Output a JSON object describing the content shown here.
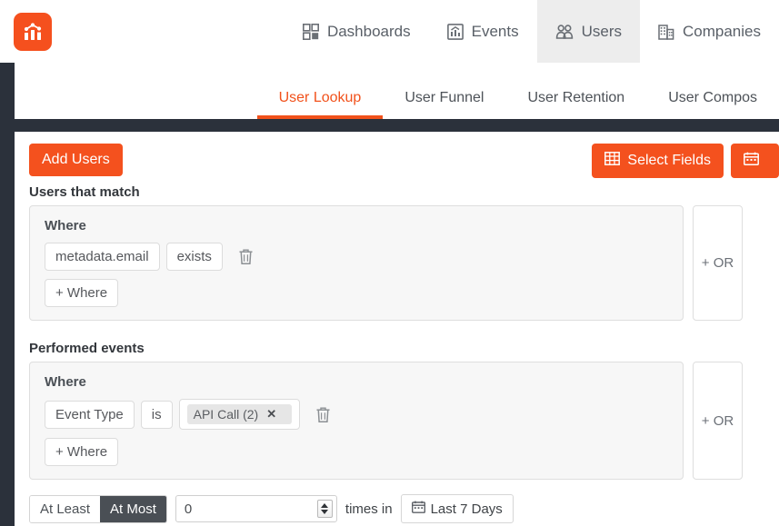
{
  "brand": {
    "logo_icon": "chart-m-logo-icon",
    "accent_color": "#f4511e",
    "dark_color": "#2b313b"
  },
  "topnav": {
    "items": [
      {
        "label": "Dashboards",
        "icon": "grid-icon",
        "active": false
      },
      {
        "label": "Events",
        "icon": "chart-line-icon",
        "active": false
      },
      {
        "label": "Users",
        "icon": "users-icon",
        "active": true
      },
      {
        "label": "Companies",
        "icon": "building-icon",
        "active": false
      }
    ]
  },
  "tabs": {
    "items": [
      {
        "label": "User Lookup",
        "active": true
      },
      {
        "label": "User Funnel",
        "active": false
      },
      {
        "label": "User Retention",
        "active": false
      },
      {
        "label": "User Compos",
        "active": false
      }
    ]
  },
  "toolbar": {
    "add_users_label": "Add Users",
    "select_fields_label": "Select Fields",
    "select_fields_icon": "table-icon",
    "date_button_icon": "calendar-icon",
    "date_button_label": ""
  },
  "users_match": {
    "title": "Users that match",
    "where_label": "Where",
    "field": "metadata.email",
    "operator": "exists",
    "delete_icon": "trash-icon",
    "add_where_label": "+ Where",
    "or_label": "+ OR"
  },
  "performed_events": {
    "title": "Performed events",
    "where_label": "Where",
    "field": "Event Type",
    "operator": "is",
    "value_token": "API Call (2)",
    "token_remove_icon": "close-icon",
    "delete_icon": "trash-icon",
    "add_where_label": "+ Where",
    "or_label": "+ OR"
  },
  "frequency": {
    "at_least_label": "At Least",
    "at_most_label": "At Most",
    "selected": "At Most",
    "count_value": "0",
    "times_in_label": "times in",
    "date_range_label": "Last 7 Days",
    "date_range_icon": "calendar-icon"
  }
}
